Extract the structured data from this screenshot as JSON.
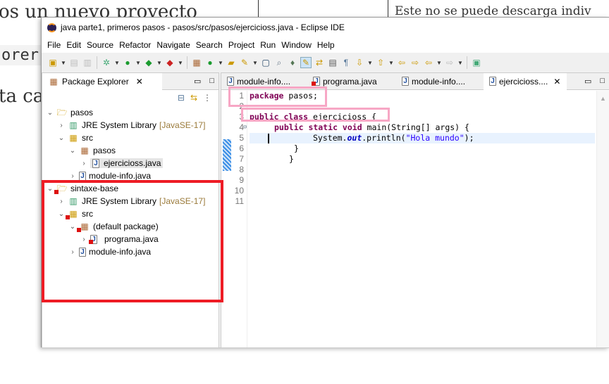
{
  "background": {
    "text1": "os un nuevo proyecto",
    "text2": "orer",
    "text3": "ta ca",
    "text4": "Este no se puede descarga indiv"
  },
  "window": {
    "title": "java parte1, primeros pasos - pasos/src/pasos/ejercicioss.java - Eclipse IDE"
  },
  "menu": [
    "File",
    "Edit",
    "Source",
    "Refactor",
    "Navigate",
    "Search",
    "Project",
    "Run",
    "Window",
    "Help"
  ],
  "package_explorer": {
    "title": "Package Explorer",
    "tree": [
      {
        "label": "pasos",
        "icon": "project-folder-icon",
        "expanded": true
      },
      {
        "label": "JRE System Library",
        "suffix": "[JavaSE-17]",
        "icon": "library-icon"
      },
      {
        "label": "src",
        "icon": "source-folder-icon",
        "expanded": true
      },
      {
        "label": "pasos",
        "icon": "package-icon",
        "expanded": true
      },
      {
        "label": "ejercicioss.java",
        "icon": "java-file-icon",
        "selected": true
      },
      {
        "label": "module-info.java",
        "icon": "java-file-icon"
      },
      {
        "label": "sintaxe-base",
        "icon": "project-folder-icon",
        "error": true,
        "expanded": true
      },
      {
        "label": "JRE System Library",
        "suffix": "[JavaSE-17]",
        "icon": "library-icon"
      },
      {
        "label": "src",
        "icon": "source-folder-icon",
        "error": true,
        "expanded": true
      },
      {
        "label": "(default package)",
        "icon": "package-icon",
        "error": true,
        "expanded": true
      },
      {
        "label": "programa.java",
        "icon": "java-file-icon",
        "error": true
      },
      {
        "label": "module-info.java",
        "icon": "java-file-icon"
      }
    ]
  },
  "editor": {
    "tabs": [
      {
        "label": "module-info...."
      },
      {
        "label": "programa.java",
        "error": true
      },
      {
        "label": "module-info...."
      },
      {
        "label": "ejercicioss....",
        "active": true
      }
    ],
    "lines": [
      "1",
      "2",
      "3",
      "4",
      "5",
      "6",
      "7",
      "8",
      "9",
      "10",
      "11"
    ],
    "code": {
      "l1_kw": "package",
      "l1_rest": " pasos;",
      "l3_kw": "public class",
      "l3_rest": " ejercicioss {",
      "l4_kw": "public static void",
      "l4_rest": " main(String[] args) {",
      "l5_a": "System.",
      "l5_field": "out",
      "l5_b": ".println(",
      "l5_str": "\"Hola mundo\"",
      "l5_c": ");",
      "l6": "}",
      "l7": "}"
    }
  },
  "colors": {
    "highlight_box": "#f7a7c5",
    "red_box": "#ee1c25",
    "keyword": "#7f0055",
    "string": "#2a00ff"
  }
}
